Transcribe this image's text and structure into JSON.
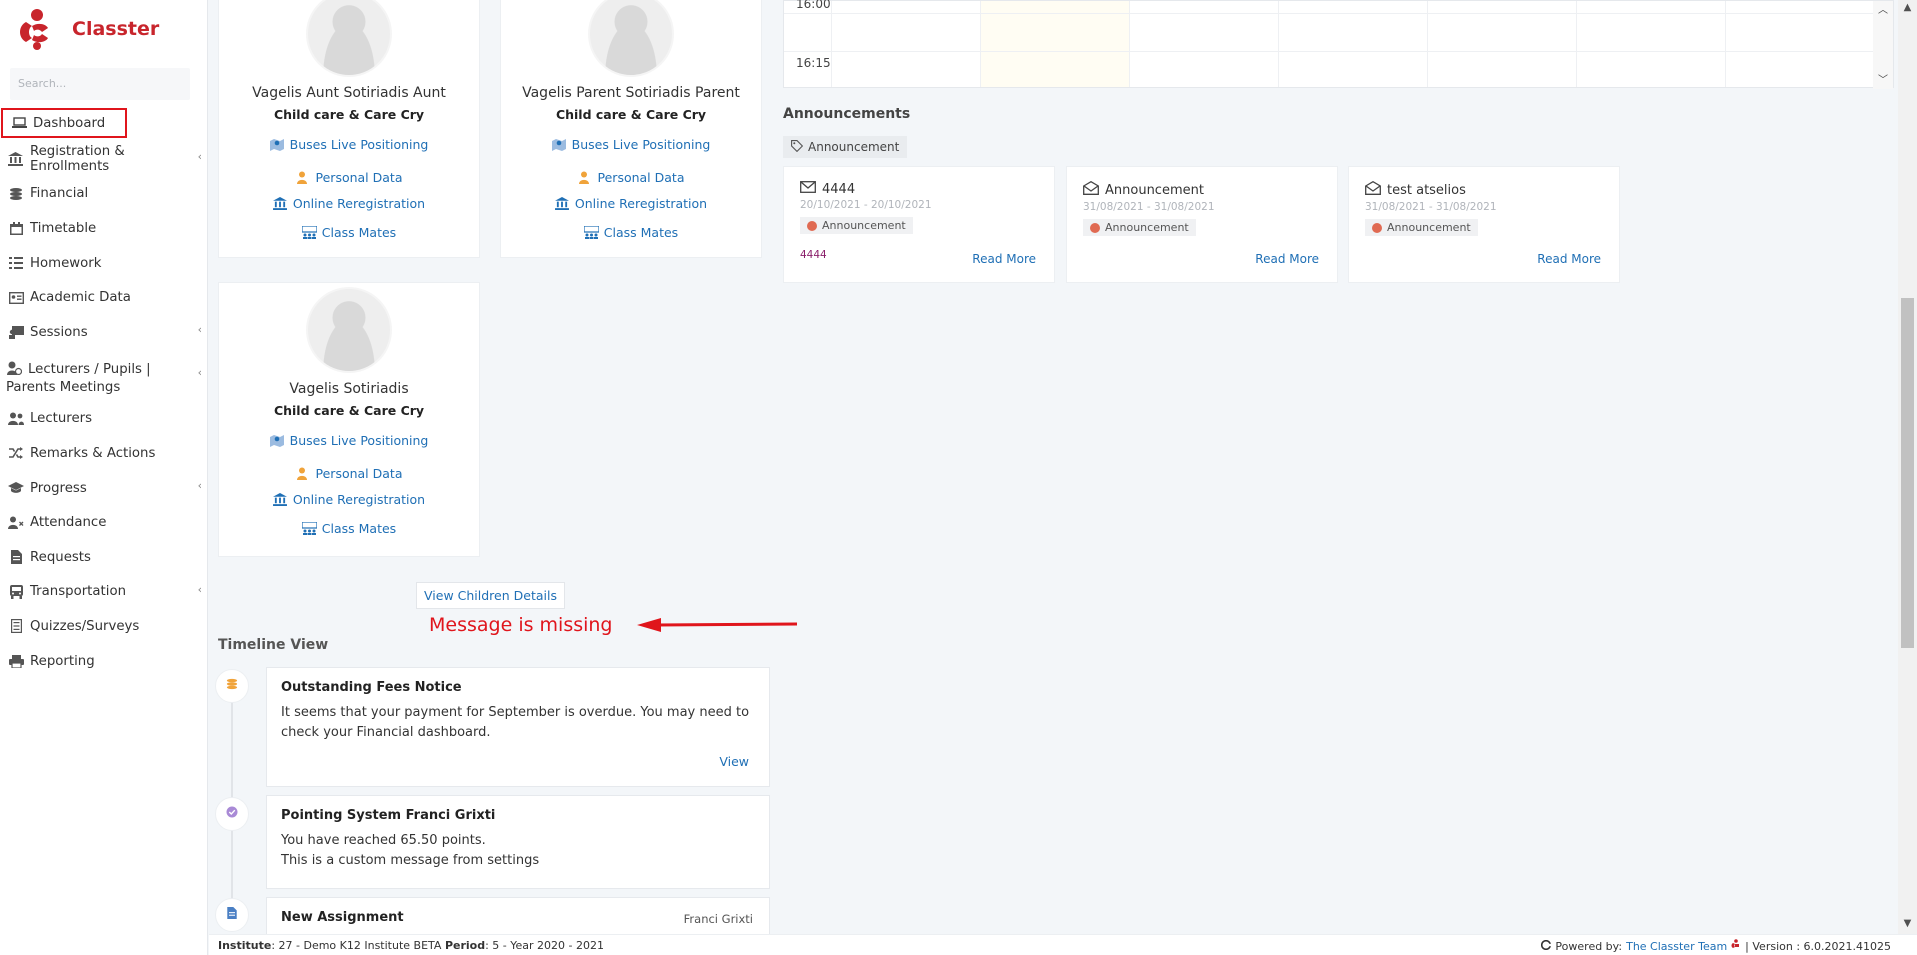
{
  "app": {
    "name": "Classter",
    "brand_color": "#c8252c"
  },
  "search": {
    "placeholder": "Search..."
  },
  "sidebar": {
    "items": [
      {
        "label": "Dashboard",
        "icon": "laptop-icon",
        "active": true
      },
      {
        "label": "Registration & Enrollments",
        "icon": "institution-icon",
        "chevron": true
      },
      {
        "label": "Financial",
        "icon": "coins-icon"
      },
      {
        "label": "Timetable",
        "icon": "calendar-icon"
      },
      {
        "label": "Homework",
        "icon": "list-icon"
      },
      {
        "label": "Academic Data",
        "icon": "id-card-icon"
      },
      {
        "label": "Sessions",
        "icon": "presentation-icon",
        "chevron": true
      },
      {
        "label": "Lecturers / Pupils | Parents Meetings",
        "icon": "user-clock-icon",
        "chevron": true
      },
      {
        "label": "Lecturers",
        "icon": "users-icon"
      },
      {
        "label": "Remarks & Actions",
        "icon": "shuffle-icon"
      },
      {
        "label": "Progress",
        "icon": "graduation-cap-icon",
        "chevron": true
      },
      {
        "label": "Attendance",
        "icon": "user-x-icon"
      },
      {
        "label": "Requests",
        "icon": "document-icon"
      },
      {
        "label": "Transportation",
        "icon": "bus-icon",
        "chevron": true
      },
      {
        "label": "Quizzes/Surveys",
        "icon": "checklist-icon"
      },
      {
        "label": "Reporting",
        "icon": "printer-icon"
      }
    ]
  },
  "children": [
    {
      "name": "Vagelis Aunt Sotiriadis Aunt",
      "school": "Child care & Care Cry"
    },
    {
      "name": "Vagelis Parent Sotiriadis Parent",
      "school": "Child care & Care Cry"
    },
    {
      "name": "Vagelis Sotiriadis",
      "school": "Child care & Care Cry"
    }
  ],
  "child_links": {
    "buses": "Buses Live Positioning",
    "personal": "Personal Data",
    "rereg": "Online Reregistration",
    "mates": "Class Mates"
  },
  "view_children_label": "View Children Details",
  "annotation": {
    "text": "Message is missing",
    "color": "#e0151c"
  },
  "timetable": {
    "times": [
      "16:00",
      "16:15"
    ]
  },
  "announcements": {
    "title": "Announcements",
    "filter_tag": "Announcement",
    "items": [
      {
        "title": "4444",
        "dates": "20/10/2021 - 20/10/2021",
        "badge": "Announcement",
        "body": "4444",
        "read_more": "Read More"
      },
      {
        "title": "Announcement",
        "dates": "31/08/2021 - 31/08/2021",
        "badge": "Announcement",
        "body": "",
        "read_more": "Read More"
      },
      {
        "title": "test atselios",
        "dates": "31/08/2021 - 31/08/2021",
        "badge": "Announcement",
        "body": "",
        "read_more": "Read More"
      }
    ]
  },
  "timeline": {
    "title": "Timeline View",
    "items": [
      {
        "title": "Outstanding Fees Notice",
        "text": "It seems that your payment for September is overdue. You may need to check your Financial dashboard.",
        "link": "View"
      },
      {
        "title": "Pointing System Franci Grixti",
        "line1": "You have reached 65.50 points.",
        "line2": "This is a custom message from settings"
      },
      {
        "title": "New Assignment",
        "author": "Franci Grixti"
      }
    ]
  },
  "footer": {
    "institute_label": "Institute",
    "institute_value": ": 27 - Demo K12 Institute BETA",
    "period_label": "Period",
    "period_value": ": 5 - Year 2020 - 2021",
    "powered_by": "Powered by:",
    "powered_link": "The Classter Team",
    "version": "| Version : 6.0.2021.41025"
  }
}
